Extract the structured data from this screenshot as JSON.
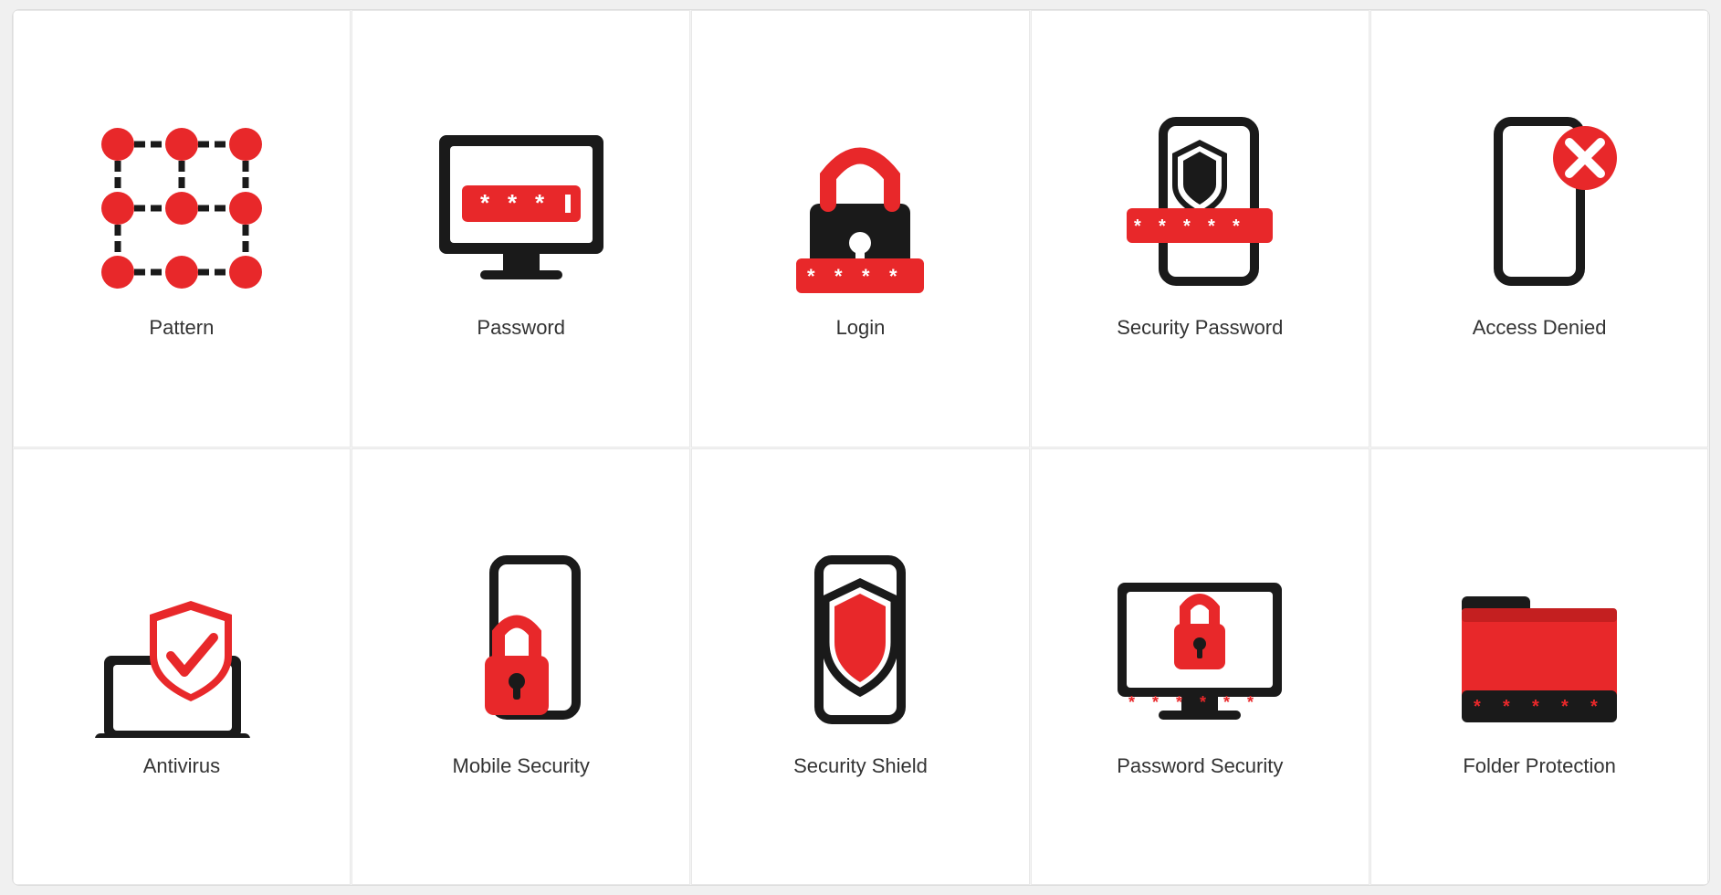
{
  "icons": [
    {
      "id": "pattern",
      "label": "Pattern"
    },
    {
      "id": "password",
      "label": "Password"
    },
    {
      "id": "login",
      "label": "Login"
    },
    {
      "id": "security-password",
      "label": "Security Password"
    },
    {
      "id": "access-denied",
      "label": "Access Denied"
    },
    {
      "id": "antivirus",
      "label": "Antivirus"
    },
    {
      "id": "mobile-security",
      "label": "Mobile Security"
    },
    {
      "id": "security-shield",
      "label": "Security Shield"
    },
    {
      "id": "password-security",
      "label": "Password Security"
    },
    {
      "id": "folder-protection",
      "label": "Folder Protection"
    }
  ],
  "colors": {
    "red": "#e8282a",
    "black": "#1a1a1a",
    "white": "#ffffff"
  }
}
